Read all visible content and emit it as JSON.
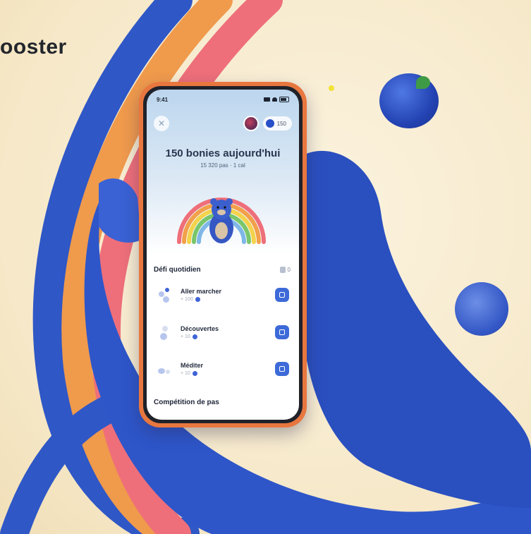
{
  "page": {
    "brand_text": "ooster"
  },
  "phone": {
    "status_time": "9:41",
    "points_value": "150",
    "headline": "150 bonies aujourd'hui",
    "subline": "15 320 pas · 1 cal",
    "daily_section_title": "Défi quotidien",
    "daily_section_side": "0",
    "challenges": [
      {
        "title": "Aller marcher",
        "meta": "+ 100"
      },
      {
        "title": "Découvertes",
        "meta": "+ 10"
      },
      {
        "title": "Méditer",
        "meta": "+ 10"
      }
    ],
    "steps_section_title": "Compétition de pas"
  },
  "colors": {
    "accent_blue": "#3d6ad8",
    "phone_case": "#e8773f",
    "background": "#f6e8c8"
  }
}
